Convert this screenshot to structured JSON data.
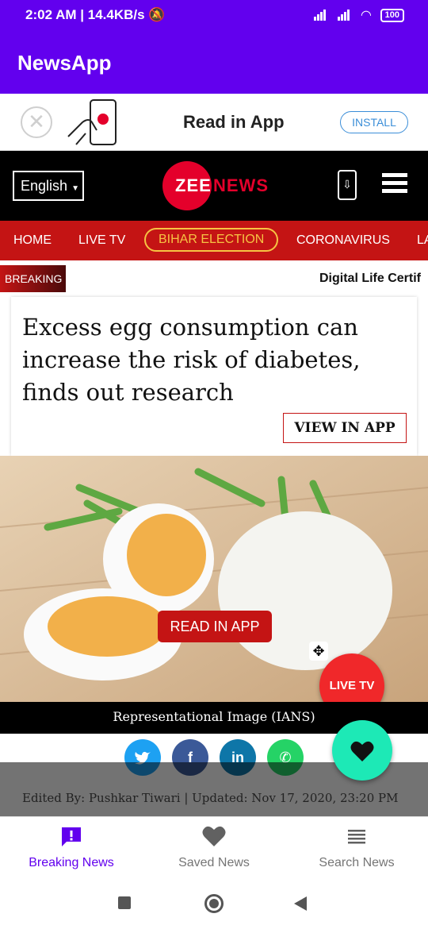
{
  "status_bar": {
    "time": "2:02 AM",
    "speed": "14.4KB/s",
    "battery": "100"
  },
  "app_bar": {
    "title": "NewsApp"
  },
  "install_banner": {
    "text": "Read in App",
    "install_label": "INSTALL",
    "close_glyph": "✕"
  },
  "site_header": {
    "language": "English",
    "logo_zee": "ZEE",
    "logo_news": "NEWS"
  },
  "nav": {
    "items": [
      "HOME",
      "LIVE TV",
      "BIHAR ELECTION",
      "CORONAVIRUS",
      "LA"
    ]
  },
  "breaking": {
    "tag": "BREAKING",
    "ticker": "Digital Life Certif"
  },
  "article": {
    "headline": "Excess egg consumption can increase the risk of diabetes, finds out research",
    "view_in_app": "VIEW IN APP",
    "read_in_app": "READ IN APP",
    "caption": "Representational Image (IANS)",
    "edited": "Edited By: Pushkar Tiwari | Updated: Nov 17, 2020, 23:20 PM"
  },
  "floating": {
    "live_tv": "LIVE TV"
  },
  "share": {
    "twitter": "twitter-icon",
    "facebook": "facebook-icon",
    "linkedin": "in",
    "whatsapp": "whatsapp-icon"
  },
  "bottom_nav": {
    "items": [
      {
        "label": "Breaking News",
        "icon": "alert-icon",
        "active": true
      },
      {
        "label": "Saved News",
        "icon": "heart-icon",
        "active": false
      },
      {
        "label": "Search News",
        "icon": "list-icon",
        "active": false
      }
    ]
  },
  "colors": {
    "primary": "#6200ee",
    "zee_red": "#c41414",
    "accent_teal": "#1de9b6",
    "live_red": "#f0282a"
  }
}
